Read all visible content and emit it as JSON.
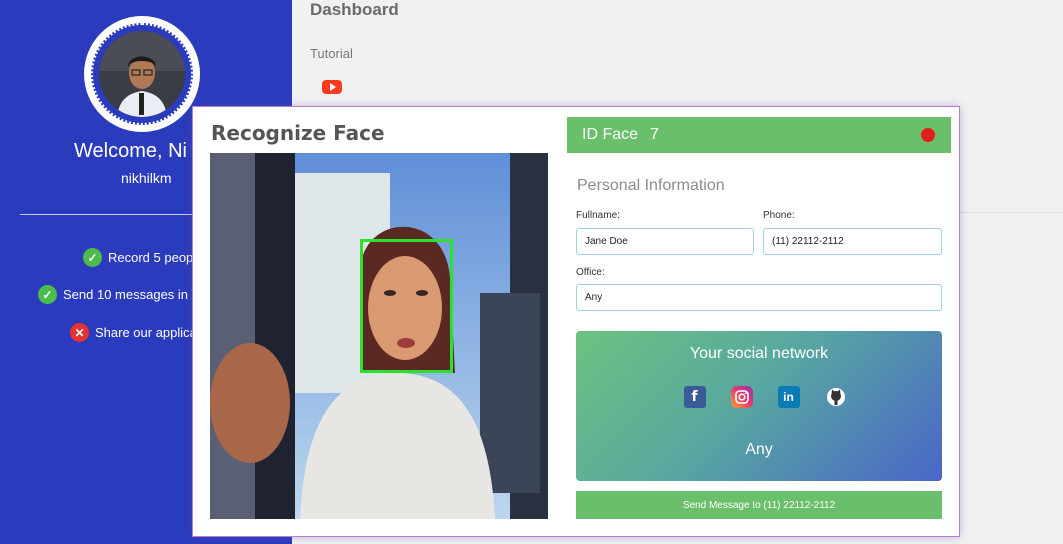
{
  "sidebar": {
    "welcome": "Welcome, Ni",
    "username": "nikhilkm",
    "tasks": [
      {
        "label": "Record 5 peop",
        "status": "done",
        "icon": "check-circle-icon"
      },
      {
        "label": "Send 10 messages in V",
        "status": "done",
        "icon": "check-circle-icon"
      },
      {
        "label": "Share our applica",
        "status": "failed",
        "icon": "x-circle-icon"
      }
    ],
    "accent_color": "#2a3cbd"
  },
  "main": {
    "title": "Dashboard",
    "tutorial_label": "Tutorial",
    "tutorial_icon": "youtube-icon"
  },
  "modal": {
    "title": "Recognize Face",
    "id_label": "ID Face",
    "id_value": "7",
    "recording_indicator_color": "#e01e1e",
    "section_title": "Personal Information",
    "fields": {
      "fullname": {
        "label": "Fullname:",
        "value": "Jane Doe"
      },
      "phone": {
        "label": "Phone:",
        "value": "(11) 22112-2112"
      },
      "office": {
        "label": "Office:",
        "value": "Any"
      }
    },
    "social": {
      "title": "Your social network",
      "icons": [
        "facebook-icon",
        "instagram-icon",
        "linkedin-icon",
        "github-icon"
      ],
      "value": "Any"
    },
    "send_button": "Send Message to (11) 22112-2112",
    "header_color": "#6abf6a"
  }
}
